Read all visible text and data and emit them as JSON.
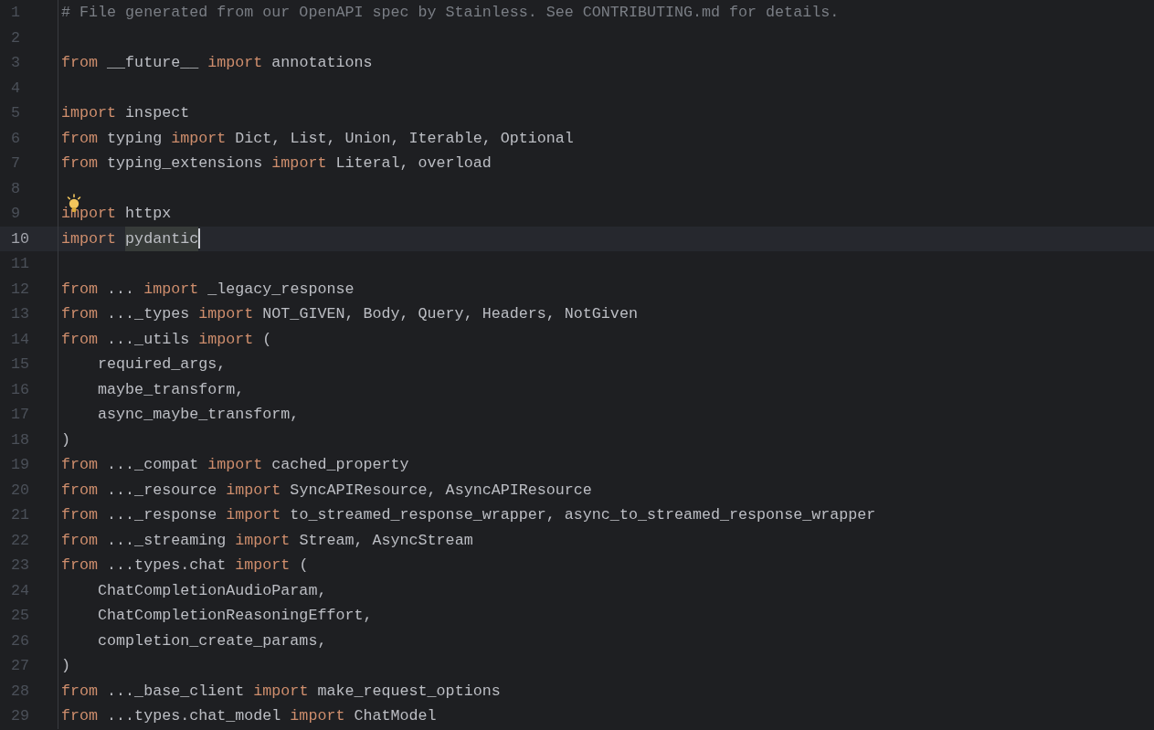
{
  "editor": {
    "lines": [
      {
        "number": "1",
        "current": false,
        "bulb": false,
        "tokens": [
          {
            "kind": "comment",
            "text": "# File generated from our OpenAPI spec by Stainless. See CONTRIBUTING.md for details."
          }
        ]
      },
      {
        "number": "2",
        "current": false,
        "bulb": false
      },
      {
        "number": "3",
        "current": false,
        "bulb": false,
        "tokens": [
          {
            "kind": "keyword",
            "text": "from"
          },
          {
            "kind": "plain",
            "text": " __future__ "
          },
          {
            "kind": "keyword",
            "text": "import"
          },
          {
            "kind": "plain",
            "text": " annotations"
          }
        ]
      },
      {
        "number": "4",
        "current": false,
        "bulb": false
      },
      {
        "number": "5",
        "current": false,
        "bulb": false,
        "tokens": [
          {
            "kind": "keyword",
            "text": "import"
          },
          {
            "kind": "plain",
            "text": " inspect"
          }
        ]
      },
      {
        "number": "6",
        "current": false,
        "bulb": false,
        "tokens": [
          {
            "kind": "keyword",
            "text": "from"
          },
          {
            "kind": "plain",
            "text": " typing "
          },
          {
            "kind": "keyword",
            "text": "import"
          },
          {
            "kind": "plain",
            "text": " Dict, List, Union, Iterable, Optional"
          }
        ]
      },
      {
        "number": "7",
        "current": false,
        "bulb": false,
        "tokens": [
          {
            "kind": "keyword",
            "text": "from"
          },
          {
            "kind": "plain",
            "text": " typing_extensions "
          },
          {
            "kind": "keyword",
            "text": "import"
          },
          {
            "kind": "plain",
            "text": " Literal, overload"
          }
        ]
      },
      {
        "number": "8",
        "current": false,
        "bulb": false
      },
      {
        "number": "9",
        "current": false,
        "bulb": true,
        "tokens": [
          {
            "kind": "keyword",
            "text": "import"
          },
          {
            "kind": "plain",
            "text": " httpx"
          }
        ]
      },
      {
        "number": "10",
        "current": true,
        "bulb": false,
        "tokens": [
          {
            "kind": "keyword",
            "text": "import "
          },
          {
            "kind": "highlight",
            "text": "pydantic"
          }
        ]
      },
      {
        "number": "11",
        "current": false,
        "bulb": false
      },
      {
        "number": "12",
        "current": false,
        "bulb": false,
        "tokens": [
          {
            "kind": "keyword",
            "text": "from"
          },
          {
            "kind": "plain",
            "text": " ... "
          },
          {
            "kind": "keyword",
            "text": "import"
          },
          {
            "kind": "plain",
            "text": " _legacy_response"
          }
        ]
      },
      {
        "number": "13",
        "current": false,
        "bulb": false,
        "tokens": [
          {
            "kind": "keyword",
            "text": "from"
          },
          {
            "kind": "plain",
            "text": " ..._types "
          },
          {
            "kind": "keyword",
            "text": "import"
          },
          {
            "kind": "plain",
            "text": " NOT_GIVEN, Body, Query, Headers, NotGiven"
          }
        ]
      },
      {
        "number": "14",
        "current": false,
        "bulb": false,
        "tokens": [
          {
            "kind": "keyword",
            "text": "from"
          },
          {
            "kind": "plain",
            "text": " ..._utils "
          },
          {
            "kind": "keyword",
            "text": "import"
          },
          {
            "kind": "plain",
            "text": " ("
          }
        ]
      },
      {
        "number": "15",
        "current": false,
        "bulb": false,
        "tokens": [
          {
            "kind": "plain",
            "text": "    required_args,"
          }
        ]
      },
      {
        "number": "16",
        "current": false,
        "bulb": false,
        "tokens": [
          {
            "kind": "plain",
            "text": "    maybe_transform,"
          }
        ]
      },
      {
        "number": "17",
        "current": false,
        "bulb": false,
        "tokens": [
          {
            "kind": "plain",
            "text": "    async_maybe_transform,"
          }
        ]
      },
      {
        "number": "18",
        "current": false,
        "bulb": false,
        "tokens": [
          {
            "kind": "plain",
            "text": ")"
          }
        ]
      },
      {
        "number": "19",
        "current": false,
        "bulb": false,
        "tokens": [
          {
            "kind": "keyword",
            "text": "from"
          },
          {
            "kind": "plain",
            "text": " ..._compat "
          },
          {
            "kind": "keyword",
            "text": "import"
          },
          {
            "kind": "plain",
            "text": " cached_property"
          }
        ]
      },
      {
        "number": "20",
        "current": false,
        "bulb": false,
        "tokens": [
          {
            "kind": "keyword",
            "text": "from"
          },
          {
            "kind": "plain",
            "text": " ..._resource "
          },
          {
            "kind": "keyword",
            "text": "import"
          },
          {
            "kind": "plain",
            "text": " SyncAPIResource, AsyncAPIResource"
          }
        ]
      },
      {
        "number": "21",
        "current": false,
        "bulb": false,
        "tokens": [
          {
            "kind": "keyword",
            "text": "from"
          },
          {
            "kind": "plain",
            "text": " ..._response "
          },
          {
            "kind": "keyword",
            "text": "import"
          },
          {
            "kind": "plain",
            "text": " to_streamed_response_wrapper, async_to_streamed_response_wrapper"
          }
        ]
      },
      {
        "number": "22",
        "current": false,
        "bulb": false,
        "tokens": [
          {
            "kind": "keyword",
            "text": "from"
          },
          {
            "kind": "plain",
            "text": " ..._streaming "
          },
          {
            "kind": "keyword",
            "text": "import"
          },
          {
            "kind": "plain",
            "text": " Stream, AsyncStream"
          }
        ]
      },
      {
        "number": "23",
        "current": false,
        "bulb": false,
        "tokens": [
          {
            "kind": "keyword",
            "text": "from"
          },
          {
            "kind": "plain",
            "text": " ...types.chat "
          },
          {
            "kind": "keyword",
            "text": "import"
          },
          {
            "kind": "plain",
            "text": " ("
          }
        ]
      },
      {
        "number": "24",
        "current": false,
        "bulb": false,
        "tokens": [
          {
            "kind": "plain",
            "text": "    ChatCompletionAudioParam,"
          }
        ]
      },
      {
        "number": "25",
        "current": false,
        "bulb": false,
        "tokens": [
          {
            "kind": "plain",
            "text": "    ChatCompletionReasoningEffort,"
          }
        ]
      },
      {
        "number": "26",
        "current": false,
        "bulb": false,
        "tokens": [
          {
            "kind": "plain",
            "text": "    completion_create_params,"
          }
        ]
      },
      {
        "number": "27",
        "current": false,
        "bulb": false,
        "tokens": [
          {
            "kind": "plain",
            "text": ")"
          }
        ]
      },
      {
        "number": "28",
        "current": false,
        "bulb": false,
        "tokens": [
          {
            "kind": "keyword",
            "text": "from"
          },
          {
            "kind": "plain",
            "text": " ..._base_client "
          },
          {
            "kind": "keyword",
            "text": "import"
          },
          {
            "kind": "plain",
            "text": " make_request_options"
          }
        ]
      },
      {
        "number": "29",
        "current": false,
        "bulb": false,
        "tokens": [
          {
            "kind": "keyword",
            "text": "from"
          },
          {
            "kind": "plain",
            "text": " ...types.chat_model "
          },
          {
            "kind": "keyword",
            "text": "import"
          },
          {
            "kind": "plain",
            "text": " ChatModel"
          }
        ]
      }
    ]
  }
}
